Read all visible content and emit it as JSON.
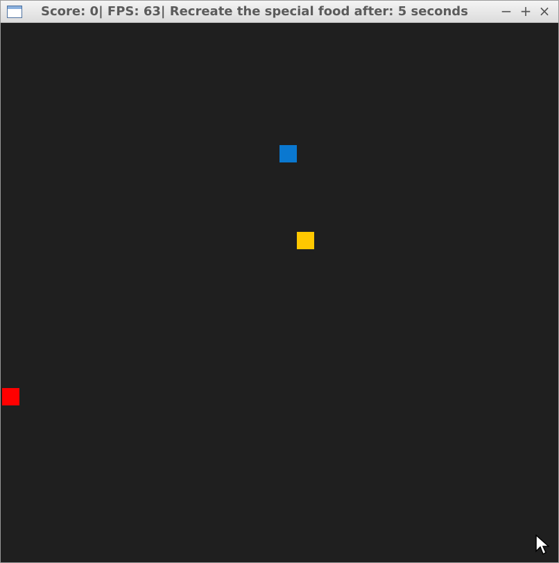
{
  "window": {
    "title": "Score: 0| FPS: 63| Recreate the special food after: 5 seconds",
    "controls": {
      "minimize": "−",
      "maximize": "+",
      "close": "×"
    },
    "icon": "window-app-icon"
  },
  "game": {
    "background_color": "#1f1f1f",
    "objects": [
      {
        "name": "special-food-tile",
        "color": "#0a78d0"
      },
      {
        "name": "food-tile",
        "color": "#ffc800"
      },
      {
        "name": "snake-head-tile",
        "color": "#ff0000"
      }
    ]
  },
  "icons": {
    "cursor": "mouse-pointer-icon"
  }
}
